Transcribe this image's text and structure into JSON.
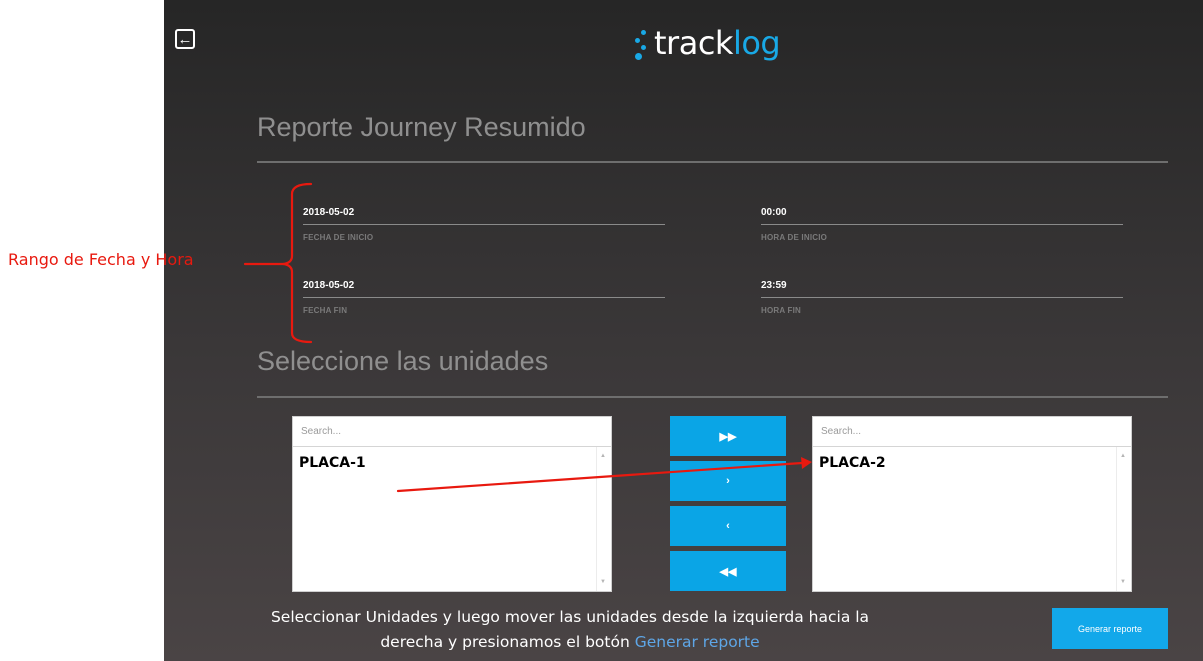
{
  "header": {
    "back_icon": "arrow-left-icon",
    "logo_text_main": "track",
    "logo_text_accent": "log"
  },
  "report": {
    "title": "Reporte Journey Resumido",
    "fields": {
      "start_date": {
        "value": "2018-05-02",
        "label": "FECHA DE INICIO"
      },
      "start_time": {
        "value": "00:00",
        "label": "HORA DE INICIO"
      },
      "end_date": {
        "value": "2018-05-02",
        "label": "FECHA FIN"
      },
      "end_time": {
        "value": "23:59",
        "label": "HORA FIN"
      }
    }
  },
  "units": {
    "title": "Seleccione las unidades",
    "left": {
      "search_placeholder": "Search...",
      "items": [
        "PLACA-1"
      ]
    },
    "right": {
      "search_placeholder": "Search...",
      "items": [
        "PLACA-2"
      ]
    },
    "buttons": {
      "move_all_right": "double-chevron-right-icon",
      "move_right": "chevron-right-icon",
      "move_left": "chevron-left-icon",
      "move_all_left": "double-chevron-left-icon"
    }
  },
  "actions": {
    "generate_label": "Generar reporte"
  },
  "annotations": {
    "range_label": "Rango de Fecha y Hora",
    "caption_line1": "Seleccionar Unidades y luego mover las unidades desde la izquierda hacia la",
    "caption_line2": "derecha y presionamos el botón",
    "caption_highlight": "Generar reporte",
    "color": "#e8190f"
  },
  "colors": {
    "accent": "#0aa5e6",
    "background": "#2e2c2d"
  }
}
